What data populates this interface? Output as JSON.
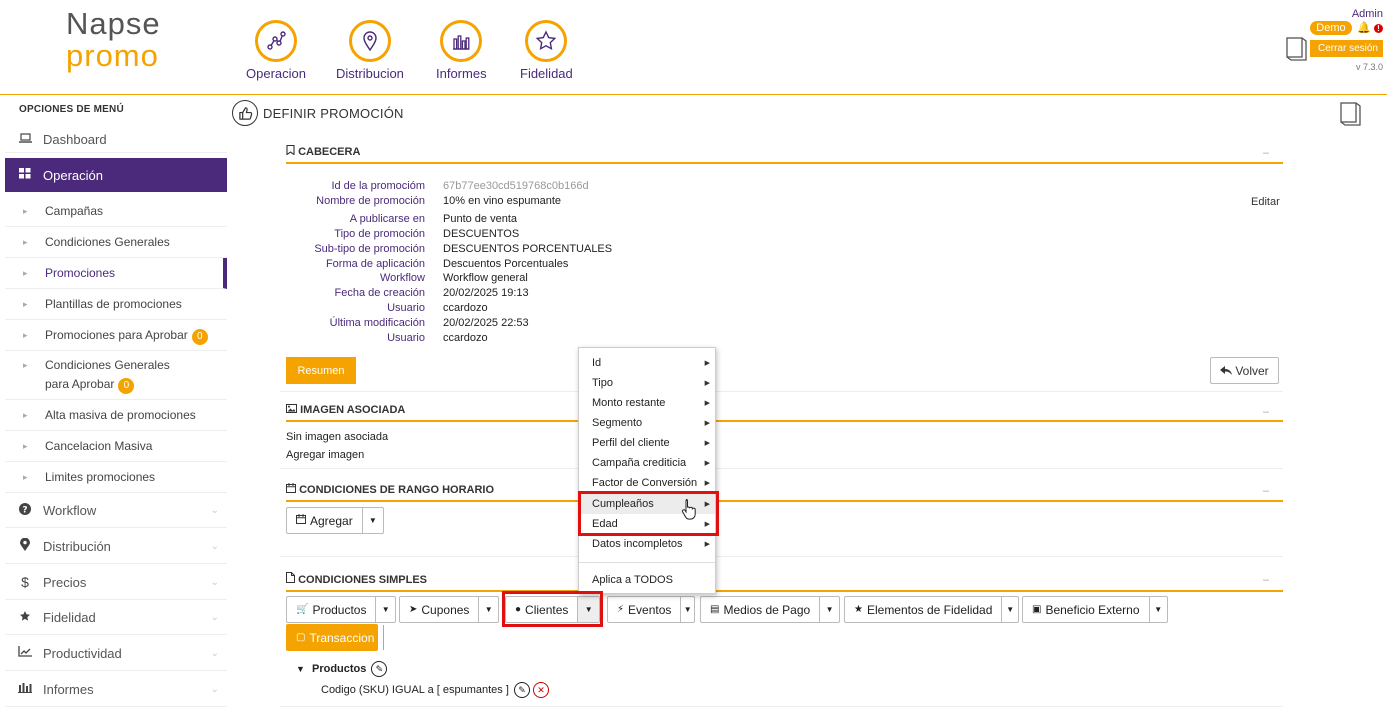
{
  "brand": {
    "line1": "Napse",
    "line2": "promo"
  },
  "topnav": [
    {
      "label": "Operacion",
      "icon": "graph-nodes-icon"
    },
    {
      "label": "Distribucion",
      "icon": "map-pin-icon"
    },
    {
      "label": "Informes",
      "icon": "bar-chart-icon"
    },
    {
      "label": "Fidelidad",
      "icon": "star-icon"
    }
  ],
  "user": {
    "name": "Admin",
    "badge": "Demo",
    "alert": "!",
    "logout": "Cerrar sesión",
    "version": "v 7.3.0"
  },
  "sidebar": {
    "title": "OPCIONES DE MENÚ",
    "dashboard": "Dashboard",
    "operacion": "Operación",
    "sub": [
      {
        "label": "Campañas"
      },
      {
        "label": "Condiciones Generales"
      },
      {
        "label": "Promociones"
      },
      {
        "label": "Plantillas de promociones"
      },
      {
        "label": "Promociones para Aprobar",
        "badge": "0"
      },
      {
        "label": "Condiciones Generales para Aprobar",
        "badge": "0"
      },
      {
        "label": "Alta masiva de promociones"
      },
      {
        "label": "Cancelacion Masiva"
      },
      {
        "label": "Limites promociones"
      }
    ],
    "sections": [
      {
        "label": "Workflow"
      },
      {
        "label": "Distribución"
      },
      {
        "label": "Precios"
      },
      {
        "label": "Fidelidad"
      },
      {
        "label": "Productividad"
      },
      {
        "label": "Informes"
      }
    ]
  },
  "page": {
    "title": "DEFINIR PROMOCIÓN"
  },
  "cabecera": {
    "title": "CABECERA",
    "minimize": "–",
    "edit": "Editar",
    "fields": [
      {
        "label": "Id de la promocióm",
        "value": "67b77ee30cd519768c0b166d"
      },
      {
        "label": "Nombre de promoción",
        "value": "10% en vino espumante"
      },
      {
        "label": "A publicarse en",
        "value": "Punto de venta"
      },
      {
        "label": "Tipo de promoción",
        "value": "DESCUENTOS"
      },
      {
        "label": "Sub-tipo de promoción",
        "value": "DESCUENTOS PORCENTUALES"
      },
      {
        "label": "Forma de aplicación",
        "value": "Descuentos Porcentuales"
      },
      {
        "label": "Workflow",
        "value": "Workflow general"
      },
      {
        "label": "Fecha de creación",
        "value": "20/02/2025 19:13"
      },
      {
        "label": "Usuario",
        "value": "ccardozo"
      },
      {
        "label": "Última modificación",
        "value": "20/02/2025 22:53"
      },
      {
        "label": "Usuario",
        "value": "ccardozo"
      }
    ],
    "resumen": "Resumen",
    "volver": "Volver"
  },
  "imagen": {
    "title": "IMAGEN ASOCIADA",
    "minimize": "–",
    "none": "Sin imagen asociada",
    "add": "Agregar imagen"
  },
  "horario": {
    "title": "CONDICIONES DE RANGO HORARIO",
    "minimize": "–",
    "add": "Agregar"
  },
  "simples": {
    "title": "CONDICIONES SIMPLES",
    "minimize": "–",
    "buttons": [
      "Productos",
      "Cupones",
      "Clientes",
      "Eventos",
      "Medios de Pago",
      "Elementos de Fidelidad",
      "Beneficio Externo",
      "Transaccion"
    ],
    "tree_title": "Productos",
    "tree_item": "Codigo (SKU) IGUAL a [ espumantes ]"
  },
  "context_menu": {
    "items": [
      "Id",
      "Tipo",
      "Monto restante",
      "Segmento",
      "Perfil del cliente",
      "Campaña crediticia",
      "Factor de Conversión",
      "Cumpleaños",
      "Edad",
      "Datos incompletos"
    ],
    "apply_all": "Aplica a TODOS",
    "hovered": "Cumpleaños"
  },
  "colors": {
    "accent": "#f4a300",
    "brand": "#4b2a7b",
    "highlight": "#e01010"
  }
}
